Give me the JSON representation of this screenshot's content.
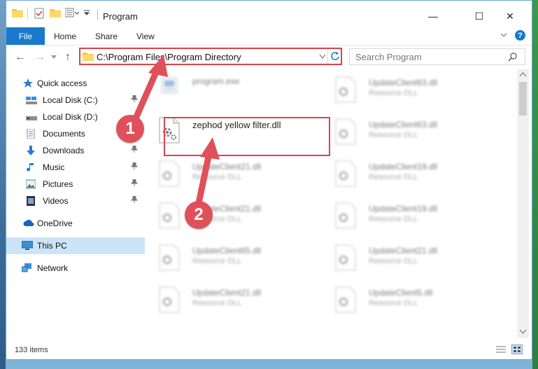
{
  "window": {
    "title": "Program",
    "controls": {
      "minimize": "—",
      "maximize": "☐",
      "close": "✕"
    }
  },
  "ribbon": {
    "tabs": [
      "File",
      "Home",
      "Share",
      "View"
    ],
    "help": "?"
  },
  "navigation": {
    "back": "←",
    "forward": "→",
    "up": "↑",
    "address_path": "C:\\Program Files\\Program Directory",
    "search_placeholder": "Search Program"
  },
  "sidebar": {
    "items": [
      {
        "label": "Quick access",
        "icon": "star-icon",
        "pinned": false
      },
      {
        "label": "Local Disk (C:)",
        "icon": "drive-icon",
        "pinned": true
      },
      {
        "label": "Local Disk (D:)",
        "icon": "drive-icon",
        "pinned": false
      },
      {
        "label": "Documents",
        "icon": "documents-icon",
        "pinned": true
      },
      {
        "label": "Downloads",
        "icon": "download-icon",
        "pinned": true
      },
      {
        "label": "Music",
        "icon": "music-icon",
        "pinned": true
      },
      {
        "label": "Pictures",
        "icon": "pictures-icon",
        "pinned": true
      },
      {
        "label": "Videos",
        "icon": "videos-icon",
        "pinned": true
      },
      {
        "label": "OneDrive",
        "icon": "cloud-icon",
        "pinned": false
      },
      {
        "label": "This PC",
        "icon": "computer-icon",
        "pinned": false,
        "selected": true
      },
      {
        "label": "Network",
        "icon": "network-icon",
        "pinned": false
      }
    ],
    "pin_glyph": "📌"
  },
  "files": {
    "highlighted": {
      "name": "zephod yellow filter.dll"
    },
    "left_column": [
      {
        "name": "program.exe",
        "type": ""
      },
      {
        "name": "UpdateClient21.dll",
        "type": "Resource DLL"
      },
      {
        "name": "UpdateClient21.dll",
        "type": "Resource DLL"
      },
      {
        "name": "UpdateClient65.dll",
        "type": "Resource DLL"
      },
      {
        "name": "UpdateClient21.dll",
        "type": "Resource DLL"
      }
    ],
    "right_column": [
      {
        "name": "UpdateClient63.dll",
        "type": "Resource DLL"
      },
      {
        "name": "UpdateClient63.dll",
        "type": "Resource DLL"
      },
      {
        "name": "UpdateClient19.dll",
        "type": "Resource DLL"
      },
      {
        "name": "UpdateClient19.dll",
        "type": "Resource DLL"
      },
      {
        "name": "UpdateClient21.dll",
        "type": "Resource DLL"
      },
      {
        "name": "UpdateClient5.dll",
        "type": "Resource DLL"
      }
    ]
  },
  "status": {
    "item_count": "133 items"
  },
  "annotations": {
    "step1": "1",
    "step2": "2",
    "color": "#e0505a"
  }
}
